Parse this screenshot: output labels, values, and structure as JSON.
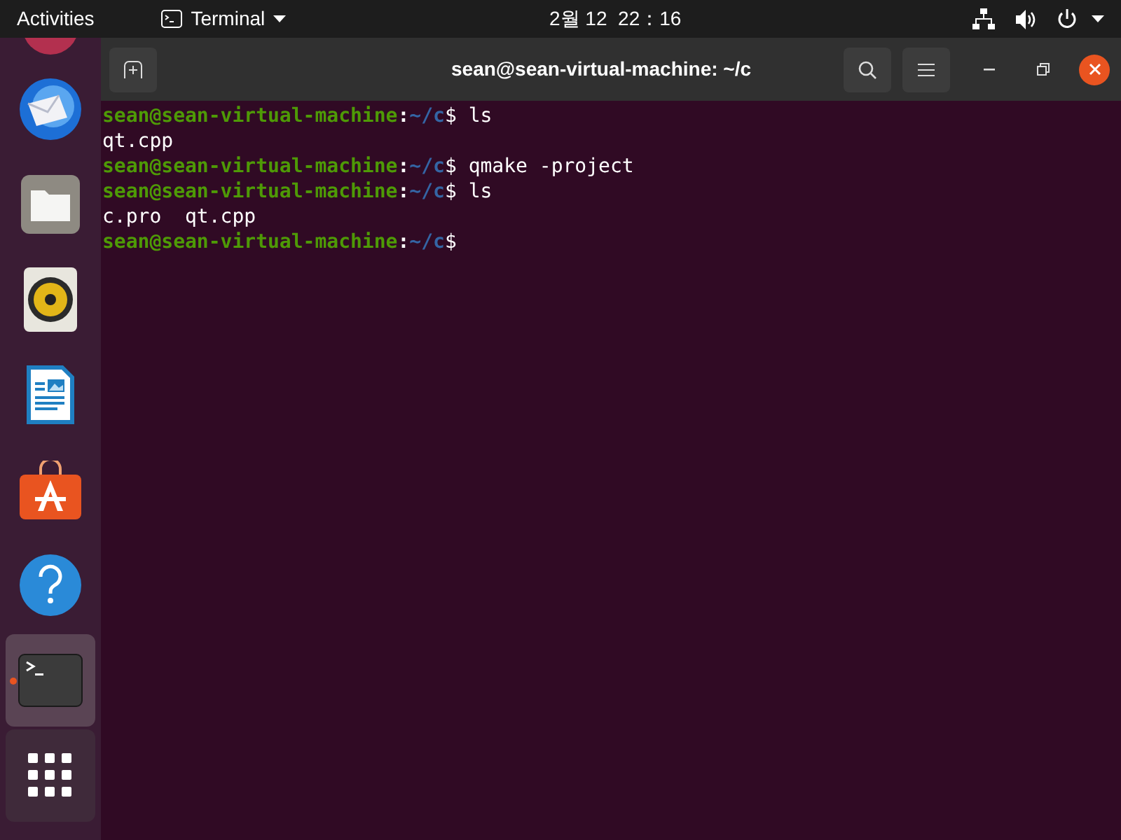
{
  "top_bar": {
    "activities": "Activities",
    "app_menu": "Terminal",
    "clock": "2월 12  22：16"
  },
  "dock": [
    {
      "kind": "partial",
      "running": false
    },
    {
      "kind": "mail",
      "running": false
    },
    {
      "kind": "files",
      "running": false
    },
    {
      "kind": "speaker",
      "running": false
    },
    {
      "kind": "writer",
      "running": false
    },
    {
      "kind": "store",
      "running": false
    },
    {
      "kind": "help",
      "running": false
    },
    {
      "kind": "terminal",
      "running": true
    },
    {
      "kind": "grid",
      "running": false
    }
  ],
  "window": {
    "title": "sean@sean-virtual-machine: ~/c"
  },
  "terminal": {
    "lines": [
      {
        "kind": "prompt",
        "user_host": "sean@sean-virtual-machine",
        "colon": ":",
        "path": "~/c",
        "dollar": "$",
        "command": "ls"
      },
      {
        "kind": "output",
        "text": "qt.cpp"
      },
      {
        "kind": "prompt",
        "user_host": "sean@sean-virtual-machine",
        "colon": ":",
        "path": "~/c",
        "dollar": "$",
        "command": "qmake -project"
      },
      {
        "kind": "prompt",
        "user_host": "sean@sean-virtual-machine",
        "colon": ":",
        "path": "~/c",
        "dollar": "$",
        "command": "ls"
      },
      {
        "kind": "output",
        "text": "c.pro  qt.cpp"
      },
      {
        "kind": "prompt",
        "user_host": "sean@sean-virtual-machine",
        "colon": ":",
        "path": "~/c",
        "dollar": "$"
      }
    ]
  }
}
